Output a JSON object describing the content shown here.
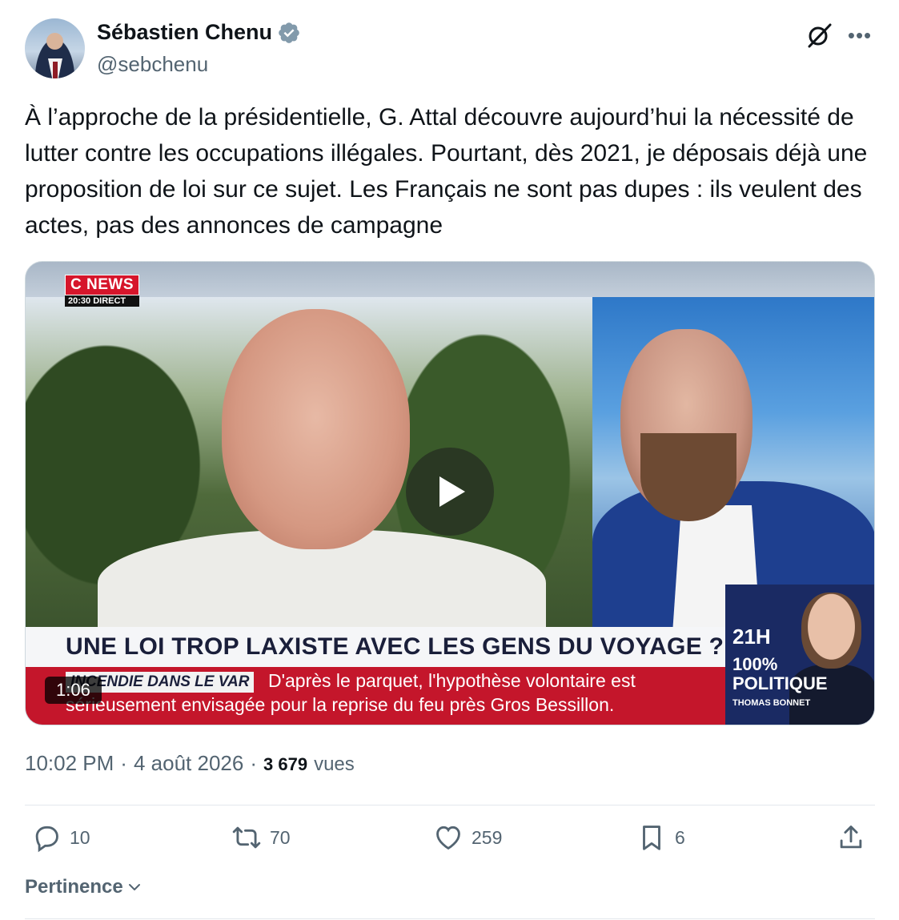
{
  "author": {
    "name": "Sébastien Chenu",
    "handle": "@sebchenu",
    "verified_color": "#829aab"
  },
  "tweet": {
    "text": "À l’approche de la présidentielle, G. Attal découvre aujourd’hui la nécessité de lutter contre les occupations illégales. Pourtant, dès 2021, je déposais déjà une proposition de loi sur ce sujet. Les Français ne sont pas dupes : ils veulent des actes, pas des annonces de campagne"
  },
  "video": {
    "duration": "1:06",
    "channel_logo": "C NEWS",
    "channel_time": "20:30",
    "channel_live": "DIRECT",
    "headline": "UNE LOI TROP LAXISTE AVEC LES GENS DU VOYAGE ?",
    "ticker_tag": "INCENDIE DANS LE VAR",
    "ticker_line1": "D'après le parquet, l'hypothèse volontaire est",
    "ticker_line2": "sérieusement envisagée pour la reprise du feu près Gros Bessillon.",
    "show_time": "21H",
    "show_name_1": "100%",
    "show_name_2": "POLITIQUE",
    "show_host": "THOMAS BONNET"
  },
  "meta": {
    "time": "10:02 PM",
    "sep": "·",
    "date": "4 août 2026",
    "views_count": "3 679",
    "views_label": "vues"
  },
  "actions": {
    "replies": "10",
    "retweets": "70",
    "likes": "259",
    "bookmarks": "6"
  },
  "sort": {
    "label": "Pertinence"
  },
  "colors": {
    "text": "#0f1419",
    "secondary": "#536471",
    "divider": "#e3e8ec"
  }
}
